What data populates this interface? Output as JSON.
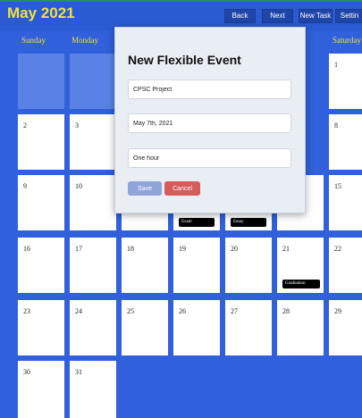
{
  "header": {
    "month_title": "May 2021",
    "buttons": {
      "back": "Back",
      "next": "Next",
      "new_task": "New Task",
      "settings": "Settin"
    }
  },
  "weekdays": {
    "sunday": "Sunday",
    "monday": "Monday",
    "saturday": "Saturday"
  },
  "calendar": {
    "days": [
      "1",
      "2",
      "3",
      "8",
      "9",
      "10",
      "15",
      "16",
      "17",
      "18",
      "19",
      "20",
      "21",
      "22",
      "23",
      "24",
      "25",
      "26",
      "27",
      "28",
      "29",
      "30",
      "31"
    ],
    "tasks": {
      "exam": "Exam",
      "essay": "Essay",
      "graduation": "Graduation"
    }
  },
  "modal": {
    "title": "New Flexible Event",
    "fields": {
      "name": "CPSC Project",
      "date": "May 7th, 2021",
      "duration": "One hour"
    },
    "save_label": "Save",
    "cancel_label": "Cancel"
  },
  "colors": {
    "background": "#3060db",
    "accent": "#f0e040",
    "save": "#8fa4d9",
    "cancel": "#d65b5b"
  }
}
